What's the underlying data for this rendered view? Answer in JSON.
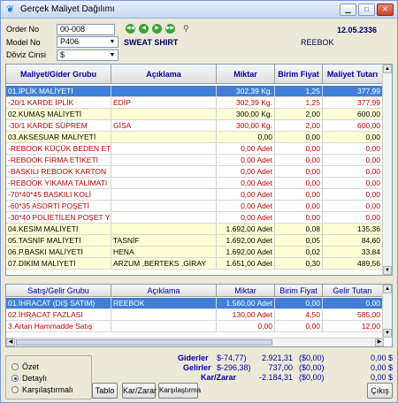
{
  "window": {
    "title": "Gerçek Maliyet Dağılımı"
  },
  "form": {
    "order_label": "Order No",
    "order_value": "00-008",
    "model_label": "Model No",
    "model_value": "P406",
    "doviz_label": "Döviz Cinsi",
    "doviz_value": "$",
    "model_name": "SWEAT SHIRT",
    "brand": "REEBOK",
    "date": "12.05.2336"
  },
  "top_grid": {
    "columns": [
      "Maliyet/Gider Grubu",
      "Açıklama",
      "Miktar",
      "Birim Fiyat",
      "Maliyet Tutarı"
    ],
    "rows": [
      {
        "c": [
          "01.İPLİK MALİYETİ",
          "",
          "302,39 Kg.",
          "1,25",
          "377,99"
        ],
        "style": "sel"
      },
      {
        "c": [
          "-20/1 KARDE İPLİK",
          "EDİP",
          "302,39 Kg.",
          "1,25",
          "377,99"
        ],
        "style": "red"
      },
      {
        "c": [
          "02.KUMAŞ MALİYETİ",
          "",
          "300,00 Kg.",
          "2,00",
          "600,00"
        ],
        "style": "y"
      },
      {
        "c": [
          "-30/1 KARDE SÜPREM",
          "GİSA",
          "300,00 Kg.",
          "2,00",
          "600,00"
        ],
        "style": "red"
      },
      {
        "c": [
          "03.AKSESUAR MALİYETİ",
          "",
          "0,00",
          "0,00",
          "0,00"
        ],
        "style": "y"
      },
      {
        "c": [
          "-REBOOK KÜÇÜK BEDEN ET",
          "",
          "0,00 Adet",
          "0,00",
          "0,00"
        ],
        "style": "red"
      },
      {
        "c": [
          "-REBOOK FİRMA ETİKETİ",
          "",
          "0,00 Adet",
          "0,00",
          "0,00"
        ],
        "style": "red"
      },
      {
        "c": [
          "-BASKILI REBOOK KARTON",
          "",
          "0,00 Adet",
          "0,00",
          "0,00"
        ],
        "style": "red"
      },
      {
        "c": [
          "-REBOOK YIKAMA TALİMATI",
          "",
          "0,00 Adet",
          "0,00",
          "0,00"
        ],
        "style": "red"
      },
      {
        "c": [
          "-70*40*45 BASKILI KOLİ",
          "",
          "0,00 Adet",
          "0,00",
          "0,00"
        ],
        "style": "red"
      },
      {
        "c": [
          "-60*35 ASORTİ POŞETİ",
          "",
          "0,00 Adet",
          "0,00",
          "0,00"
        ],
        "style": "red"
      },
      {
        "c": [
          "-30*40 POLİETİLEN POŞET Y",
          "",
          "0,00 Adet",
          "0,00",
          "0,00"
        ],
        "style": "red"
      },
      {
        "c": [
          "04.KESİM MALİYETİ",
          "",
          "1.692,00 Adet",
          "0,08",
          "135,36"
        ],
        "style": "y"
      },
      {
        "c": [
          "05.TASNİF    MALİYETİ",
          "TASNİF",
          "1.692,00 Adet",
          "0,05",
          "84,60"
        ],
        "style": "y"
      },
      {
        "c": [
          "06.P.BASKI    MALİYETİ",
          "HENA",
          "1.692,00 Adet",
          "0,02",
          "33,84"
        ],
        "style": "y"
      },
      {
        "c": [
          "07.DİKİM     MALİYETİ",
          "ARZUM ,BERTEKS ,GİRAY",
          "1.651,00 Adet",
          "0,30",
          "489,56"
        ],
        "style": "y"
      }
    ]
  },
  "bottom_grid": {
    "columns": [
      "Satış/Gelir Grubu",
      "Açıklama",
      "Miktar",
      "Birim Fiyat",
      "Gelir Tutarı"
    ],
    "rows": [
      {
        "c": [
          "01.İHRACAT (DIŞ SATIM)",
          "REEBOK",
          "1.560,00 Adet",
          "0,00",
          "0,00"
        ],
        "style": "sel"
      },
      {
        "c": [
          "02.İHRACAT FAZLASI",
          "",
          "130,00 Adet",
          "4,50",
          "585,00"
        ],
        "style": "red"
      },
      {
        "c": [
          "3.Artan Hammadde Satış",
          "",
          "0,00",
          "0,00",
          "12,00"
        ],
        "style": "red"
      }
    ]
  },
  "view_options": {
    "ozet": "Özet",
    "detayli": "Detaylı",
    "karsilastirmali": "Karşılaştırmalı",
    "selected": "detayli"
  },
  "buttons": {
    "tablo": "Tablo",
    "kar_zarar": "Kar/Zarar",
    "karsilastirma": "Karşılaştırma",
    "cikis": "Çıkış"
  },
  "summary": {
    "giderler_label": "Giderler",
    "giderler_note": "$-74,77)",
    "giderler_value": "2.921,31",
    "giderler_paren": "($0,00)",
    "giderler_right": "0,00 $",
    "gelirler_label": "Gelirler",
    "gelirler_note": "$-296,38)",
    "gelirler_value": "737,00",
    "gelirler_paren": "($0,00)",
    "gelirler_right": "0,00 $",
    "karzarar_label": "Kar/Zarar",
    "karzarar_value": "-2.184,31",
    "karzarar_paren": "($0,00)",
    "karzarar_right": "0,00 $"
  }
}
